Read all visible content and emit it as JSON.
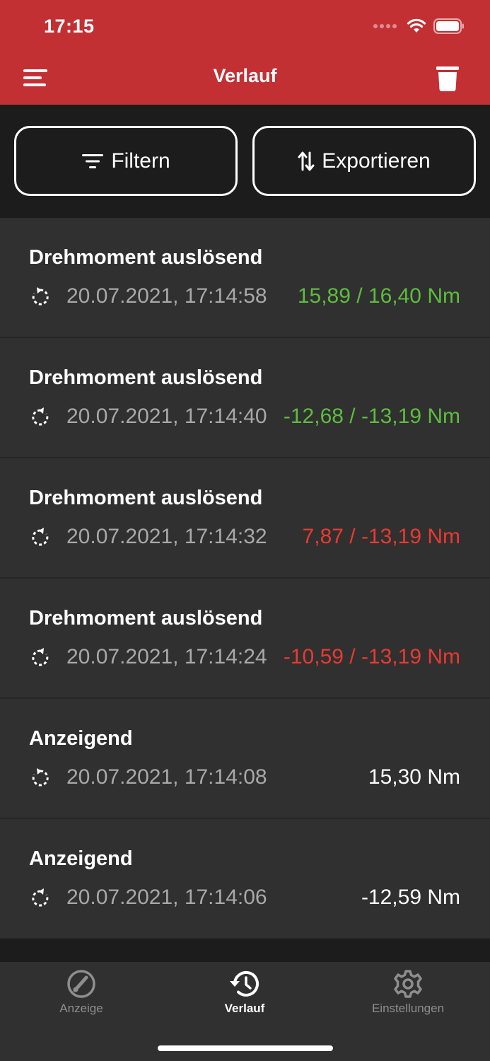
{
  "status": {
    "time": "17:15"
  },
  "header": {
    "title": "Verlauf"
  },
  "toolbar": {
    "filter_label": "Filtern",
    "export_label": "Exportieren"
  },
  "rows": [
    {
      "title": "Drehmoment auslösend",
      "datetime": "20.07.2021, 17:14:58",
      "value": "15,89 / 16,40 Nm",
      "value_color": "#5dbd3d",
      "direction": "clockwise"
    },
    {
      "title": "Drehmoment auslösend",
      "datetime": "20.07.2021, 17:14:40",
      "value": "-12,68 / -13,19 Nm",
      "value_color": "#5dbd3d",
      "direction": "counterclockwise"
    },
    {
      "title": "Drehmoment auslösend",
      "datetime": "20.07.2021, 17:14:32",
      "value": "7,87 / -13,19 Nm",
      "value_color": "#e83a31",
      "direction": "counterclockwise"
    },
    {
      "title": "Drehmoment auslösend",
      "datetime": "20.07.2021, 17:14:24",
      "value": "-10,59 / -13,19 Nm",
      "value_color": "#e83a31",
      "direction": "counterclockwise"
    },
    {
      "title": "Anzeigend",
      "datetime": "20.07.2021, 17:14:08",
      "value": "15,30 Nm",
      "value_color": "#ffffff",
      "direction": "clockwise"
    },
    {
      "title": "Anzeigend",
      "datetime": "20.07.2021, 17:14:06",
      "value": "-12,59 Nm",
      "value_color": "#ffffff",
      "direction": "counterclockwise"
    }
  ],
  "tabs": [
    {
      "label": "Anzeige",
      "icon": "gauge-icon",
      "active": false
    },
    {
      "label": "Verlauf",
      "icon": "history-icon",
      "active": true
    },
    {
      "label": "Einstellungen",
      "icon": "gear-icon",
      "active": false
    }
  ],
  "colors": {
    "brand": "#c33034",
    "success": "#5dbd3d",
    "error": "#e83a31"
  }
}
